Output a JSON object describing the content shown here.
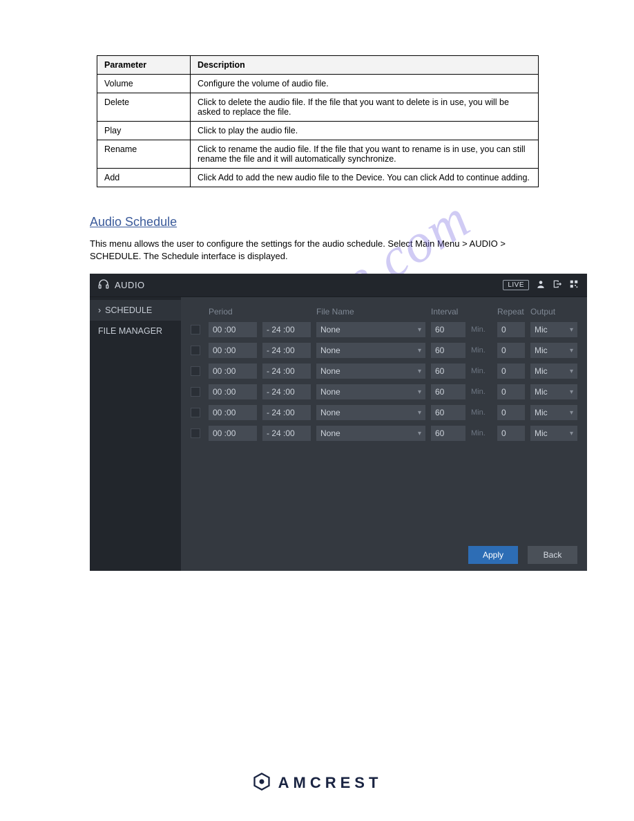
{
  "def_table": {
    "headers": [
      "Parameter",
      "Description"
    ],
    "rows": [
      [
        "Volume",
        "Configure the volume of audio file."
      ],
      [
        "Delete",
        "Click to delete the audio file. If the file that you want to delete is in use, you will be asked to replace the file."
      ],
      [
        "Play",
        "Click to play the audio file."
      ],
      [
        "Rename",
        "Click to rename the audio file. If the file that you want to rename is in use, you can still rename the file and it will automatically synchronize."
      ],
      [
        "Add",
        "Click Add to add the new audio file to the Device. You can click Add to continue adding."
      ]
    ]
  },
  "section": {
    "heading": "Audio Schedule",
    "body": "This menu allows the user to configure the settings for the audio schedule. Select Main Menu > AUDIO > SCHEDULE. The Schedule interface is displayed."
  },
  "ui": {
    "title": "AUDIO",
    "live": "LIVE",
    "sidebar": [
      {
        "label": "SCHEDULE",
        "active": true
      },
      {
        "label": "FILE MANAGER",
        "active": false
      }
    ],
    "columns": {
      "period": "Period",
      "filename": "File Name",
      "interval": "Interval",
      "repeat": "Repeat",
      "output": "Output",
      "min": "Min."
    },
    "rows": [
      {
        "start": "00 :00",
        "end": "- 24 :00",
        "file": "None",
        "interval": "60",
        "repeat": "0",
        "output": "Mic"
      },
      {
        "start": "00 :00",
        "end": "- 24 :00",
        "file": "None",
        "interval": "60",
        "repeat": "0",
        "output": "Mic"
      },
      {
        "start": "00 :00",
        "end": "- 24 :00",
        "file": "None",
        "interval": "60",
        "repeat": "0",
        "output": "Mic"
      },
      {
        "start": "00 :00",
        "end": "- 24 :00",
        "file": "None",
        "interval": "60",
        "repeat": "0",
        "output": "Mic"
      },
      {
        "start": "00 :00",
        "end": "- 24 :00",
        "file": "None",
        "interval": "60",
        "repeat": "0",
        "output": "Mic"
      },
      {
        "start": "00 :00",
        "end": "- 24 :00",
        "file": "None",
        "interval": "60",
        "repeat": "0",
        "output": "Mic"
      }
    ],
    "buttons": {
      "apply": "Apply",
      "back": "Back"
    }
  },
  "brand": "AMCREST",
  "watermark": "manualshive.com"
}
